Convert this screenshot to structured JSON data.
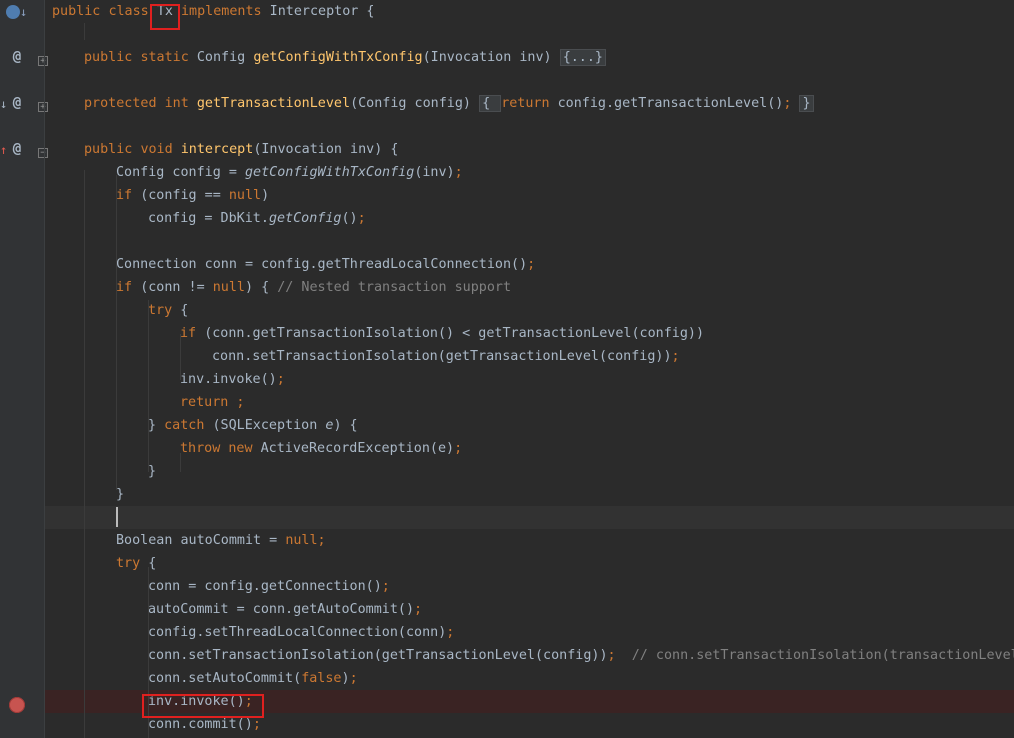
{
  "editor": {
    "language": "java",
    "lines": [
      {
        "tokens": [
          {
            "t": "public ",
            "c": "kw"
          },
          {
            "t": "class ",
            "c": "kw"
          },
          {
            "t": "Tx",
            "c": "p"
          },
          {
            "t": " implements",
            "c": "kw"
          },
          {
            "t": " Interceptor {",
            "c": "p"
          }
        ]
      },
      {
        "tokens": []
      },
      {
        "tokens": [
          {
            "t": "public ",
            "c": "kw"
          },
          {
            "t": "static ",
            "c": "kw"
          },
          {
            "t": "Config ",
            "c": "p"
          },
          {
            "t": "getConfigWithTxConfig",
            "c": "fn"
          },
          {
            "t": "(Invocation inv) ",
            "c": "p"
          },
          {
            "t": "{...}",
            "c": "fold"
          }
        ]
      },
      {
        "tokens": []
      },
      {
        "tokens": [
          {
            "t": "protected ",
            "c": "kw"
          },
          {
            "t": "int ",
            "c": "kw"
          },
          {
            "t": "getTransactionLevel",
            "c": "fn"
          },
          {
            "t": "(Config config) ",
            "c": "p"
          },
          {
            "t": "{ ",
            "c": "fold"
          },
          {
            "t": "return ",
            "c": "kw"
          },
          {
            "t": "config.getTransactionLevel()",
            "c": "p"
          },
          {
            "t": "; ",
            "c": "kw"
          },
          {
            "t": "}",
            "c": "fold"
          }
        ]
      },
      {
        "tokens": []
      },
      {
        "tokens": [
          {
            "t": "public ",
            "c": "kw"
          },
          {
            "t": "void ",
            "c": "kw"
          },
          {
            "t": "intercept",
            "c": "fn"
          },
          {
            "t": "(Invocation inv) {",
            "c": "p"
          }
        ]
      },
      {
        "tokens": [
          {
            "t": "Config config = ",
            "c": "p"
          },
          {
            "t": "getConfigWithTxConfig",
            "c": "it"
          },
          {
            "t": "(inv)",
            "c": "p"
          },
          {
            "t": ";",
            "c": "kw"
          }
        ]
      },
      {
        "tokens": [
          {
            "t": "if ",
            "c": "kw"
          },
          {
            "t": "(config == ",
            "c": "p"
          },
          {
            "t": "null",
            "c": "kw"
          },
          {
            "t": ")",
            "c": "p"
          }
        ]
      },
      {
        "tokens": [
          {
            "t": "config = DbKit.",
            "c": "p"
          },
          {
            "t": "getConfig",
            "c": "it"
          },
          {
            "t": "()",
            "c": "p"
          },
          {
            "t": ";",
            "c": "kw"
          }
        ]
      },
      {
        "tokens": []
      },
      {
        "tokens": [
          {
            "t": "Connection conn = config.getThreadLocalConnection()",
            "c": "p"
          },
          {
            "t": ";",
            "c": "kw"
          }
        ]
      },
      {
        "tokens": [
          {
            "t": "if ",
            "c": "kw"
          },
          {
            "t": "(conn != ",
            "c": "p"
          },
          {
            "t": "null",
            "c": "kw"
          },
          {
            "t": ") { ",
            "c": "p"
          },
          {
            "t": "// Nested transaction support",
            "c": "cm"
          }
        ]
      },
      {
        "tokens": [
          {
            "t": "try ",
            "c": "kw"
          },
          {
            "t": "{",
            "c": "p"
          }
        ]
      },
      {
        "tokens": [
          {
            "t": "if ",
            "c": "kw"
          },
          {
            "t": "(conn.getTransactionIsolation() < getTransactionLevel(config))",
            "c": "p"
          }
        ]
      },
      {
        "tokens": [
          {
            "t": "conn.setTransactionIsolation(getTransactionLevel(config))",
            "c": "p"
          },
          {
            "t": ";",
            "c": "kw"
          }
        ]
      },
      {
        "tokens": [
          {
            "t": "inv.invoke()",
            "c": "p"
          },
          {
            "t": ";",
            "c": "kw"
          }
        ]
      },
      {
        "tokens": [
          {
            "t": "return ;",
            "c": "kw"
          }
        ]
      },
      {
        "tokens": [
          {
            "t": "} ",
            "c": "p"
          },
          {
            "t": "catch ",
            "c": "kw"
          },
          {
            "t": "(SQLException ",
            "c": "p"
          },
          {
            "t": "e",
            "c": "it"
          },
          {
            "t": ") {",
            "c": "p"
          }
        ]
      },
      {
        "tokens": [
          {
            "t": "throw ",
            "c": "kw"
          },
          {
            "t": "new ",
            "c": "kw"
          },
          {
            "t": "ActiveRecordException(e)",
            "c": "p"
          },
          {
            "t": ";",
            "c": "kw"
          }
        ]
      },
      {
        "tokens": [
          {
            "t": "}",
            "c": "p"
          }
        ]
      },
      {
        "tokens": [
          {
            "t": "}",
            "c": "p"
          }
        ]
      },
      {
        "tokens": []
      },
      {
        "tokens": [
          {
            "t": "Boolean autoCommit = ",
            "c": "p"
          },
          {
            "t": "null;",
            "c": "kw"
          }
        ]
      },
      {
        "tokens": [
          {
            "t": "try ",
            "c": "kw"
          },
          {
            "t": "{",
            "c": "p"
          }
        ]
      },
      {
        "tokens": [
          {
            "t": "conn = config.getConnection()",
            "c": "p"
          },
          {
            "t": ";",
            "c": "kw"
          }
        ]
      },
      {
        "tokens": [
          {
            "t": "autoCommit = conn.getAutoCommit()",
            "c": "p"
          },
          {
            "t": ";",
            "c": "kw"
          }
        ]
      },
      {
        "tokens": [
          {
            "t": "config.setThreadLocalConnection(conn)",
            "c": "p"
          },
          {
            "t": ";",
            "c": "kw"
          }
        ]
      },
      {
        "tokens": [
          {
            "t": "conn.setTransactionIsolation(getTransactionLevel(config))",
            "c": "p"
          },
          {
            "t": ";  ",
            "c": "kw"
          },
          {
            "t": "// conn.setTransactionIsolation(transactionLevel",
            "c": "cm"
          }
        ]
      },
      {
        "tokens": [
          {
            "t": "conn.setAutoCommit(",
            "c": "p"
          },
          {
            "t": "false",
            "c": "kw"
          },
          {
            "t": ")",
            "c": "p"
          },
          {
            "t": ";",
            "c": "kw"
          }
        ]
      },
      {
        "tokens": [
          {
            "t": "inv.invoke()",
            "c": "p"
          },
          {
            "t": ";",
            "c": "kw"
          }
        ]
      },
      {
        "tokens": [
          {
            "t": "conn.commit()",
            "c": "p"
          },
          {
            "t": ";",
            "c": "kw"
          }
        ]
      }
    ]
  },
  "gutter": {
    "icons": [
      "implemented-icon",
      "override-at-icon",
      "implementation-at-icon",
      "overriding-at-icon",
      "breakpoint-icon"
    ]
  }
}
